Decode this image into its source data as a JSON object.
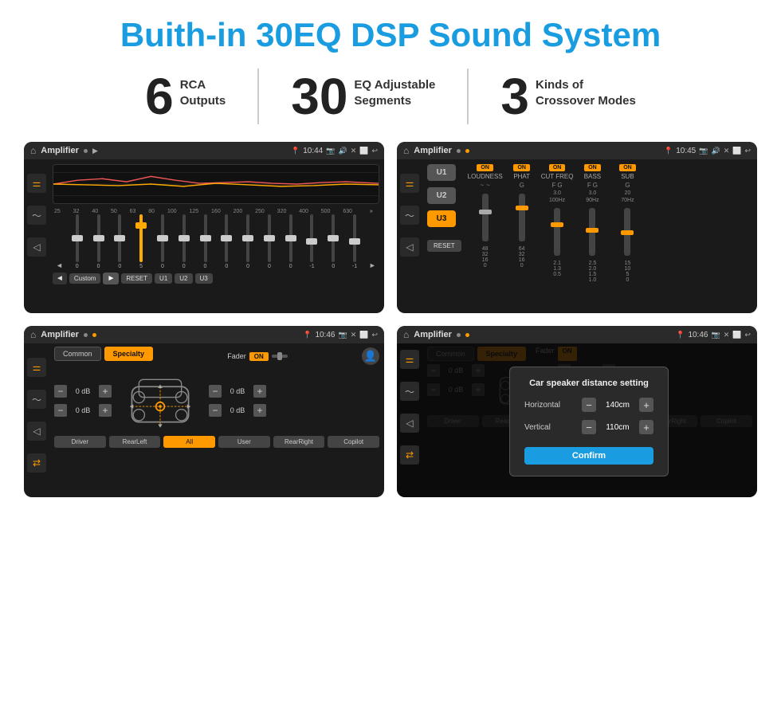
{
  "page": {
    "title": "Buith-in 30EQ DSP Sound System",
    "title_color": "#1a9de0"
  },
  "stats": [
    {
      "number": "6",
      "line1": "RCA",
      "line2": "Outputs"
    },
    {
      "number": "30",
      "line1": "EQ Adjustable",
      "line2": "Segments"
    },
    {
      "number": "3",
      "line1": "Kinds of",
      "line2": "Crossover Modes"
    }
  ],
  "screens": [
    {
      "id": "screen1",
      "status_bar": {
        "title": "Amplifier",
        "time": "10:44"
      },
      "type": "eq",
      "freq_labels": [
        "25",
        "32",
        "40",
        "50",
        "63",
        "80",
        "100",
        "125",
        "160",
        "200",
        "250",
        "320",
        "400",
        "500",
        "630"
      ],
      "slider_values": [
        "0",
        "0",
        "0",
        "5",
        "0",
        "0",
        "0",
        "0",
        "0",
        "0",
        "0",
        "-1",
        "0",
        "-1"
      ],
      "buttons": [
        "Custom",
        "RESET",
        "U1",
        "U2",
        "U3"
      ]
    },
    {
      "id": "screen2",
      "status_bar": {
        "title": "Amplifier",
        "time": "10:45"
      },
      "type": "crossover",
      "u_buttons": [
        "U1",
        "U2",
        "U3"
      ],
      "active_u": "U3",
      "channels": [
        {
          "name": "LOUDNESS",
          "on": true
        },
        {
          "name": "PHAT",
          "on": true
        },
        {
          "name": "CUT FREQ",
          "on": true
        },
        {
          "name": "BASS",
          "on": true
        },
        {
          "name": "SUB",
          "on": true
        }
      ],
      "reset_label": "RESET"
    },
    {
      "id": "screen3",
      "status_bar": {
        "title": "Amplifier",
        "time": "10:46"
      },
      "type": "fader",
      "tabs": [
        "Common",
        "Specialty"
      ],
      "active_tab": "Specialty",
      "fader_label": "Fader",
      "fader_on": "ON",
      "controls": [
        {
          "value": "0 dB"
        },
        {
          "value": "0 dB"
        },
        {
          "value": "0 dB"
        },
        {
          "value": "0 dB"
        }
      ],
      "bottom_buttons": [
        "Driver",
        "RearLeft",
        "All",
        "User",
        "RearRight",
        "Copilot"
      ]
    },
    {
      "id": "screen4",
      "status_bar": {
        "title": "Amplifier",
        "time": "10:46"
      },
      "type": "dialog",
      "dialog": {
        "title": "Car speaker distance setting",
        "fields": [
          {
            "label": "Horizontal",
            "value": "140cm"
          },
          {
            "label": "Vertical",
            "value": "110cm"
          }
        ],
        "confirm_label": "Confirm"
      }
    }
  ],
  "icons": {
    "home": "⌂",
    "back": "↩",
    "settings": "⚙",
    "location": "📍",
    "camera": "📷",
    "speaker": "🔊",
    "close": "✕",
    "window": "⬜",
    "equalizer": "≡",
    "wave": "〜",
    "speaker_sm": "◁",
    "arrows": "⇄",
    "minus": "−",
    "plus": "+"
  }
}
